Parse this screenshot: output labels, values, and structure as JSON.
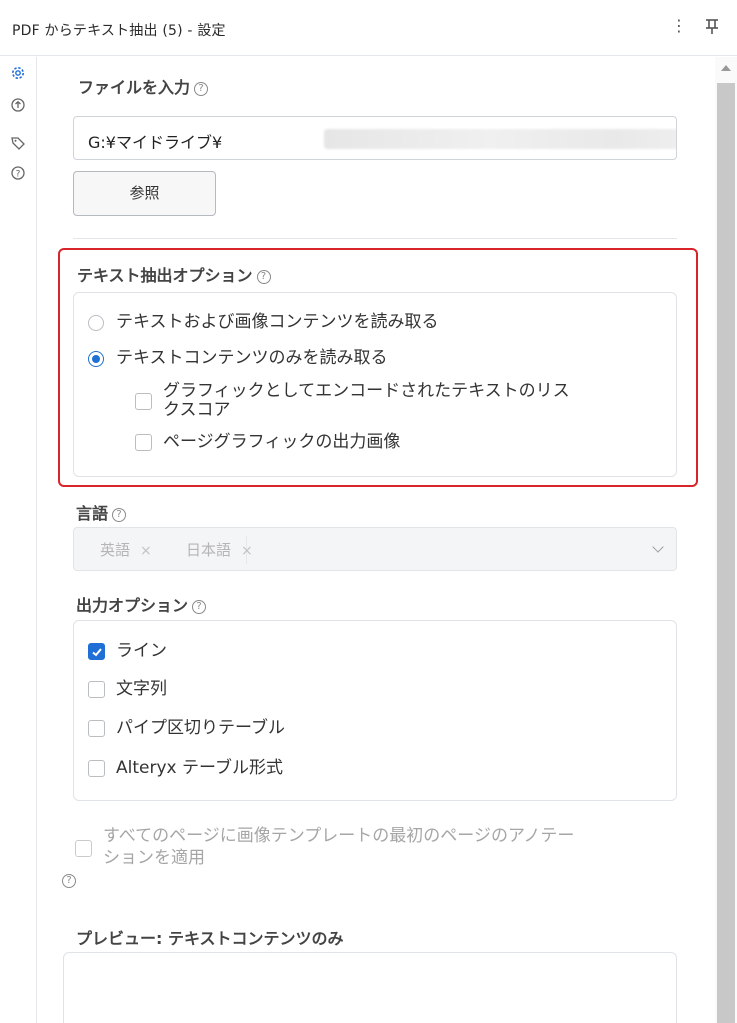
{
  "window": {
    "title": "PDF からテキスト抽出 (5) - 設定"
  },
  "icons": {
    "kebab": "more-vertical-icon",
    "pin": "pin-icon",
    "rail": [
      "gear-icon",
      "arrows-icon",
      "tag-icon",
      "help-circle-icon"
    ]
  },
  "file_input": {
    "label": "ファイルを入力",
    "value": "G:¥マイドライブ¥",
    "browse_label": "参照"
  },
  "extract_options": {
    "label": "テキスト抽出オプション",
    "radio_options": [
      {
        "label": "テキストおよび画像コンテンツを読み取る",
        "selected": false
      },
      {
        "label": "テキストコンテンツのみを読み取る",
        "selected": true
      }
    ],
    "sub_options": [
      {
        "label_line1": "グラフィックとしてエンコードされたテキストのリス",
        "label_line2": "クスコア",
        "checked": false
      },
      {
        "label_line1": "ページグラフィックの出力画像",
        "checked": false
      }
    ]
  },
  "language": {
    "label": "言語",
    "chips": [
      "英語",
      "日本語"
    ],
    "remove_glyph": "×",
    "disabled": true
  },
  "output_options": {
    "label": "出力オプション",
    "items": [
      {
        "label": "ライン",
        "checked": true
      },
      {
        "label": "文字列",
        "checked": false
      },
      {
        "label": "パイプ区切りテーブル",
        "checked": false
      },
      {
        "label": "Alteryx テーブル形式",
        "checked": false
      }
    ]
  },
  "apply_annotation": {
    "label_line1": "すべてのページに画像テンプレートの最初のページのアノテー",
    "label_line2": "ションを適用",
    "checked": false,
    "disabled": true
  },
  "help_glyph": "?",
  "preview": {
    "label": "プレビュー: テキストコンテンツのみ"
  },
  "colors": {
    "accent": "#1f6fd6",
    "highlight_border": "#d8242b"
  }
}
